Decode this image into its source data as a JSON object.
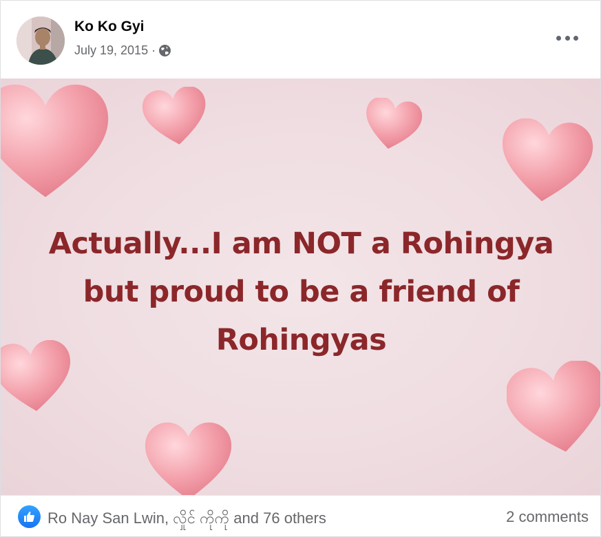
{
  "post": {
    "author": "Ko Ko Gyi",
    "date": "July 19, 2015",
    "separator": "·",
    "privacy_icon": "globe-icon",
    "more_icon": "more-horizontal-icon",
    "image_text_lines": [
      "Actually...I am NOT a Rohingya",
      "but proud to be a friend of",
      "Rohingyas"
    ],
    "reactions": {
      "icon": "like-icon",
      "text": "Ro Nay San Lwin, လှိုင် ကိုကို and 76 others"
    },
    "comments": "2 comments"
  },
  "colors": {
    "image_text": "#8b272a",
    "reaction_blue": "#1877f2",
    "secondary_text": "#65676b"
  }
}
